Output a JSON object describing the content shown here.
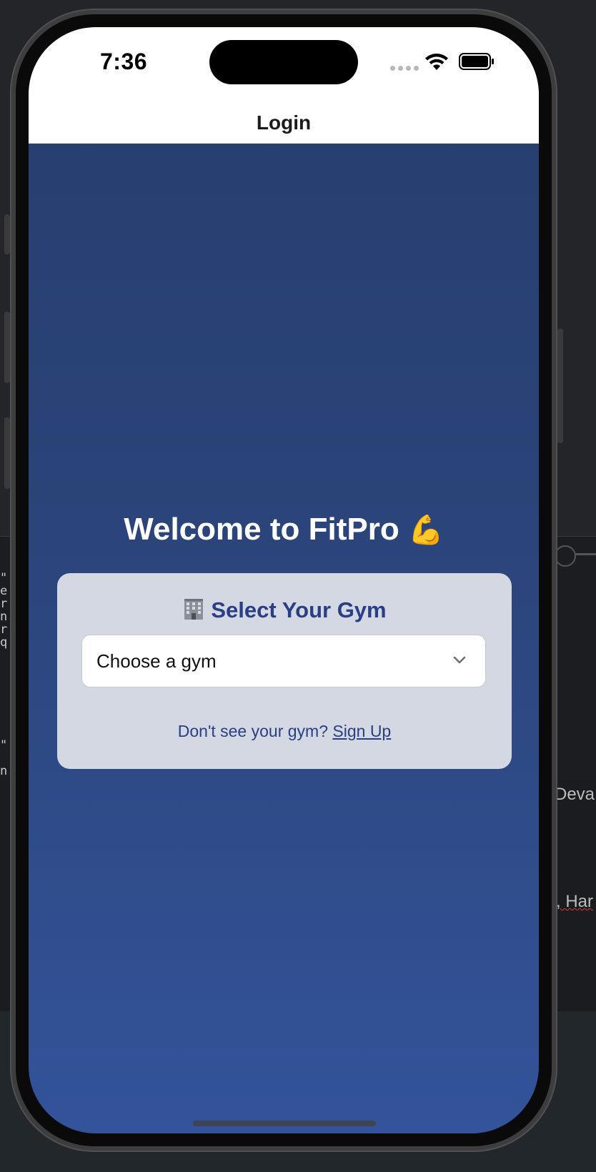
{
  "status_bar": {
    "time": "7:36"
  },
  "nav": {
    "title": "Login"
  },
  "welcome": {
    "text": "Welcome to FitPro",
    "emoji": "💪"
  },
  "gym_card": {
    "title": "Select Your Gym",
    "icon": "building-icon",
    "select": {
      "selected_value": "Choose a gym"
    },
    "signup_prompt": "Don't see your gym?",
    "signup_link": "Sign Up"
  },
  "background": {
    "side_text_1": "Deva",
    "side_text_2": ", Har"
  },
  "colors": {
    "screen_gradient_top": "#263d6e",
    "screen_gradient_bottom": "#33539a",
    "card_bg": "#d4d8e2",
    "accent_text": "#2a3e86"
  }
}
